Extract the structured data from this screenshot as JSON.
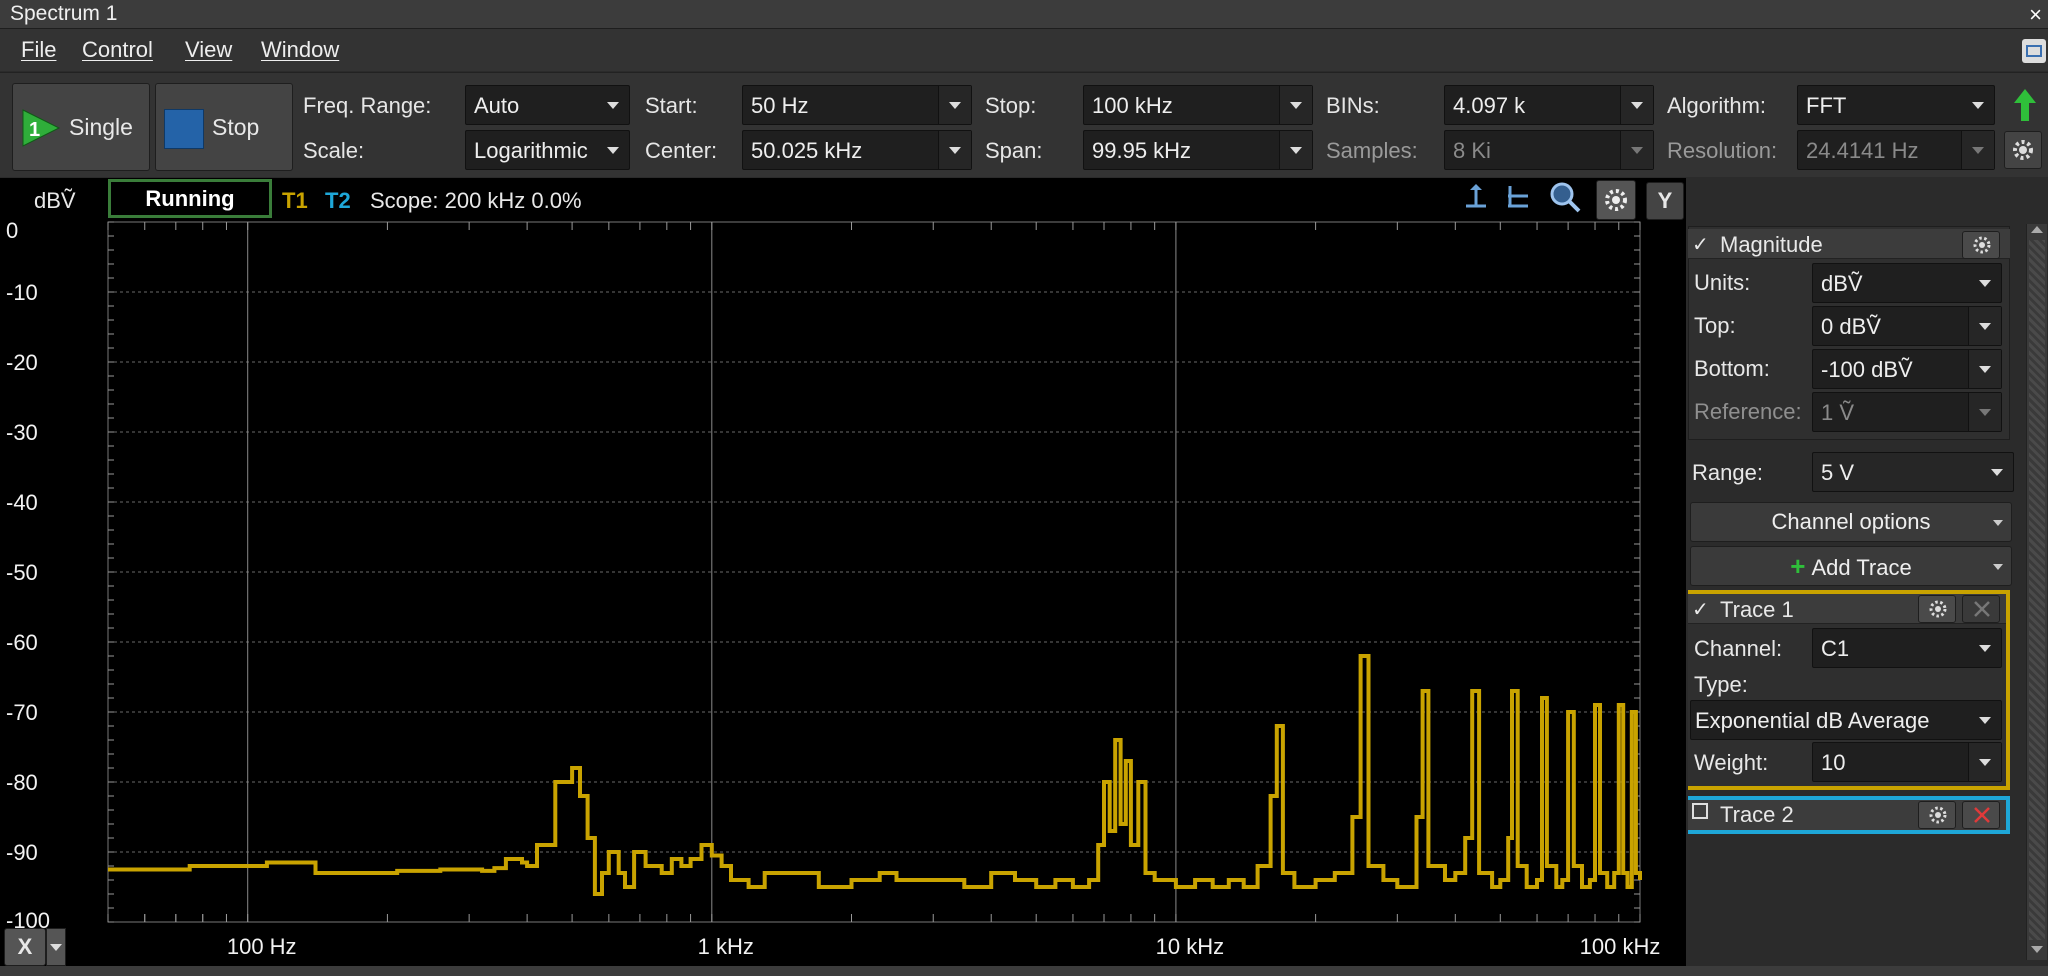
{
  "window": {
    "title": "Spectrum 1",
    "close_label": "×"
  },
  "menu": [
    "File",
    "Control",
    "View",
    "Window"
  ],
  "toolbar": {
    "single_label": "Single",
    "single_badge": "1",
    "stop_label": "Stop",
    "freq_range": {
      "label": "Freq. Range:",
      "value": "Auto"
    },
    "scale": {
      "label": "Scale:",
      "value": "Logarithmic"
    },
    "start": {
      "label": "Start:",
      "value": "50 Hz"
    },
    "center": {
      "label": "Center:",
      "value": "50.025 kHz"
    },
    "stop": {
      "label": "Stop:",
      "value": "100 kHz"
    },
    "span": {
      "label": "Span:",
      "value": "99.95 kHz"
    },
    "bins": {
      "label": "BINs:",
      "value": "4.097 k"
    },
    "samples": {
      "label": "Samples:",
      "value": "8 Ki"
    },
    "algorithm": {
      "label": "Algorithm:",
      "value": "FFT"
    },
    "resolution": {
      "label": "Resolution:",
      "value": "24.4141 Hz"
    }
  },
  "plot_header": {
    "y_unit": "dBṼ",
    "status": "Running",
    "t1": "T1",
    "t2": "T2",
    "scope": "Scope: 200 kHz 0.0%",
    "y_button": "Y",
    "x_button": "X"
  },
  "colors": {
    "trace1": "#c9a300",
    "trace2": "#1ea7d8",
    "grid": "#6a6a6a",
    "running_border": "#3a7d3a"
  },
  "chart_data": {
    "type": "line",
    "title": "",
    "xlabel": "",
    "ylabel": "dBṼ",
    "x_scale": "log",
    "xlim": [
      50,
      100000
    ],
    "ylim": [
      -100,
      0
    ],
    "y_ticks": [
      "0",
      "-10",
      "-20",
      "-30",
      "-40",
      "-50",
      "-60",
      "-70",
      "-80",
      "-90",
      "-100"
    ],
    "x_ticks": [
      {
        "value": 100,
        "label": "100 Hz"
      },
      {
        "value": 1000,
        "label": "1 kHz"
      },
      {
        "value": 10000,
        "label": "10 kHz"
      },
      {
        "value": 100000,
        "label": "100 kHz"
      }
    ],
    "grid": true,
    "series": [
      {
        "name": "T1",
        "points": [
          [
            50,
            -92.5
          ],
          [
            70,
            -92.5
          ],
          [
            75,
            -92
          ],
          [
            100,
            -92
          ],
          [
            110,
            -91.5
          ],
          [
            135,
            -91.5
          ],
          [
            140,
            -93
          ],
          [
            200,
            -93
          ],
          [
            210,
            -92.7
          ],
          [
            250,
            -92.7
          ],
          [
            260,
            -92.5
          ],
          [
            300,
            -92.5
          ],
          [
            320,
            -92.7
          ],
          [
            340,
            -92.3
          ],
          [
            360,
            -91
          ],
          [
            390,
            -91.5
          ],
          [
            400,
            -92
          ],
          [
            420,
            -89
          ],
          [
            460,
            -80
          ],
          [
            500,
            -78
          ],
          [
            520,
            -82
          ],
          [
            540,
            -88
          ],
          [
            560,
            -96
          ],
          [
            580,
            -93
          ],
          [
            600,
            -90
          ],
          [
            630,
            -93
          ],
          [
            650,
            -95
          ],
          [
            680,
            -90
          ],
          [
            720,
            -92
          ],
          [
            780,
            -93
          ],
          [
            820,
            -91
          ],
          [
            860,
            -92
          ],
          [
            900,
            -91
          ],
          [
            950,
            -89
          ],
          [
            1000,
            -90.5
          ],
          [
            1050,
            -92
          ],
          [
            1100,
            -94
          ],
          [
            1200,
            -95
          ],
          [
            1300,
            -93
          ],
          [
            1500,
            -93
          ],
          [
            1700,
            -95
          ],
          [
            2000,
            -94
          ],
          [
            2300,
            -93
          ],
          [
            2500,
            -94
          ],
          [
            3000,
            -94
          ],
          [
            3500,
            -95
          ],
          [
            4000,
            -93
          ],
          [
            4500,
            -94
          ],
          [
            5000,
            -95
          ],
          [
            5500,
            -94
          ],
          [
            6000,
            -95
          ],
          [
            6500,
            -94
          ],
          [
            6800,
            -89
          ],
          [
            7000,
            -80
          ],
          [
            7200,
            -87
          ],
          [
            7400,
            -74
          ],
          [
            7600,
            -86
          ],
          [
            7800,
            -77
          ],
          [
            8000,
            -89
          ],
          [
            8300,
            -80
          ],
          [
            8600,
            -93
          ],
          [
            9000,
            -94
          ],
          [
            10000,
            -95
          ],
          [
            11000,
            -94
          ],
          [
            12000,
            -95
          ],
          [
            13000,
            -94
          ],
          [
            14000,
            -95
          ],
          [
            15000,
            -92
          ],
          [
            16000,
            -82
          ],
          [
            16500,
            -72
          ],
          [
            17000,
            -93
          ],
          [
            18000,
            -95
          ],
          [
            20000,
            -94
          ],
          [
            22000,
            -93
          ],
          [
            24000,
            -85
          ],
          [
            25000,
            -62
          ],
          [
            26000,
            -92
          ],
          [
            28000,
            -94
          ],
          [
            30000,
            -95
          ],
          [
            33000,
            -85
          ],
          [
            34000,
            -67
          ],
          [
            35000,
            -92
          ],
          [
            38000,
            -94
          ],
          [
            40000,
            -93
          ],
          [
            42000,
            -88
          ],
          [
            43500,
            -67
          ],
          [
            45000,
            -93
          ],
          [
            48000,
            -95
          ],
          [
            50000,
            -94
          ],
          [
            52000,
            -88
          ],
          [
            53000,
            -67
          ],
          [
            54500,
            -92
          ],
          [
            57000,
            -95
          ],
          [
            60000,
            -94
          ],
          [
            61500,
            -68
          ],
          [
            63000,
            -92
          ],
          [
            66000,
            -95
          ],
          [
            68000,
            -94
          ],
          [
            70000,
            -70
          ],
          [
            72000,
            -92
          ],
          [
            75000,
            -95
          ],
          [
            78000,
            -94
          ],
          [
            80000,
            -69
          ],
          [
            82000,
            -93
          ],
          [
            85000,
            -95
          ],
          [
            88000,
            -93
          ],
          [
            90000,
            -69
          ],
          [
            92000,
            -93
          ],
          [
            94000,
            -95
          ],
          [
            96000,
            -70
          ],
          [
            98000,
            -93
          ],
          [
            100000,
            -94
          ]
        ]
      }
    ]
  },
  "side": {
    "magnitude": {
      "title": "Magnitude",
      "check": "✓",
      "units": {
        "label": "Units:",
        "value": "dBṼ"
      },
      "top": {
        "label": "Top:",
        "value": "0 dBṼ"
      },
      "bottom": {
        "label": "Bottom:",
        "value": "-100 dBṼ"
      },
      "reference": {
        "label": "Reference:",
        "value": "1 Ṽ"
      }
    },
    "range": {
      "label": "Range:",
      "value": "5 V"
    },
    "channel_options": "Channel options",
    "add_trace": "Add Trace",
    "trace1": {
      "title": "Trace 1",
      "check": "✓",
      "channel": {
        "label": "Channel:",
        "value": "C1"
      },
      "type": {
        "label": "Type:",
        "value": "Exponential dB Average"
      },
      "weight": {
        "label": "Weight:",
        "value": "10"
      }
    },
    "trace2": {
      "title": "Trace 2"
    }
  }
}
